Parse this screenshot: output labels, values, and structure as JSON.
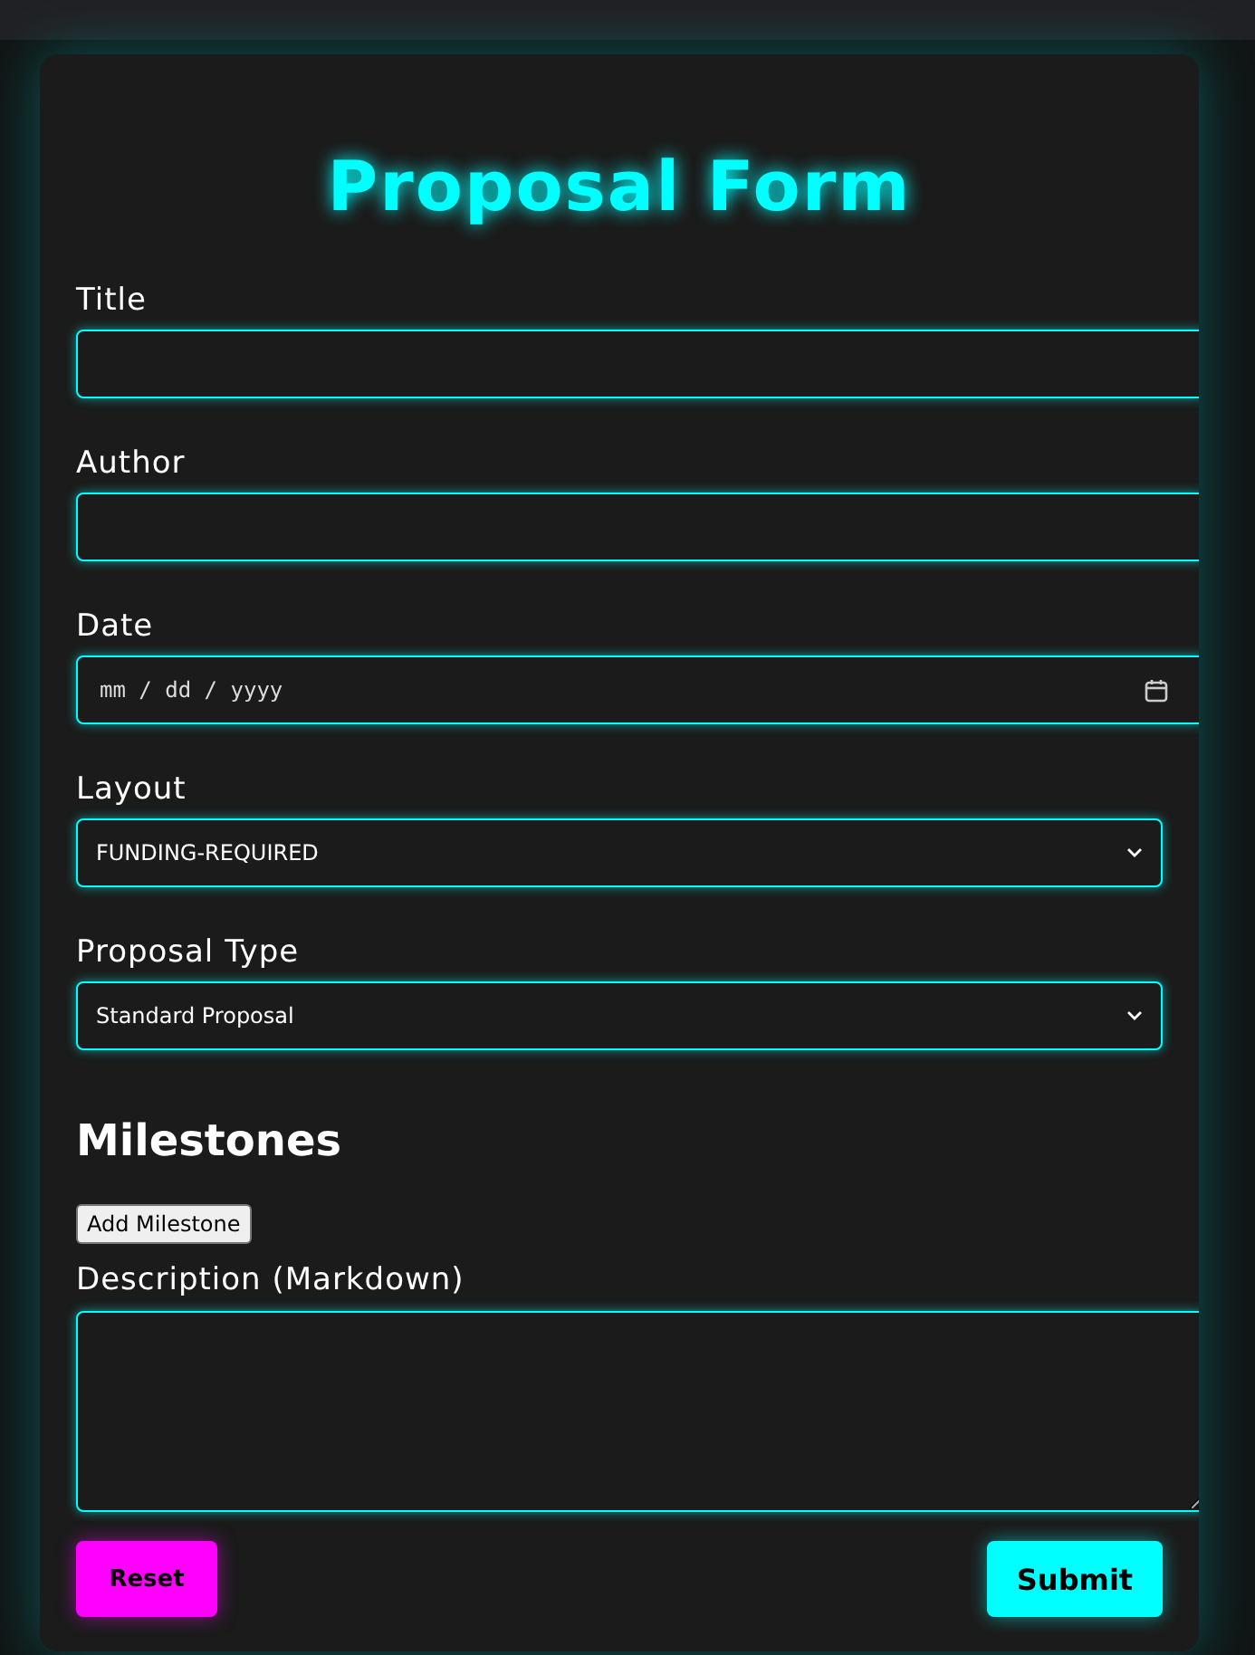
{
  "title": "Proposal Form",
  "fields": [
    {
      "kind": "text",
      "label": "Title"
    },
    {
      "kind": "text",
      "label": "Author"
    },
    {
      "kind": "date",
      "label": "Date",
      "placeholder": "mm / dd / yyyy"
    },
    {
      "kind": "select",
      "label": "Layout",
      "value": "FUNDING-REQUIRED"
    },
    {
      "kind": "select",
      "label": "Proposal Type",
      "value": "Standard Proposal"
    }
  ],
  "milestones": {
    "heading": "Milestones",
    "add_button": "Add Milestone"
  },
  "description": {
    "label": "Description (Markdown)"
  },
  "buttons": [
    {
      "kind": "reset",
      "label": "Reset"
    },
    {
      "kind": "submit",
      "label": "Submit"
    }
  ]
}
